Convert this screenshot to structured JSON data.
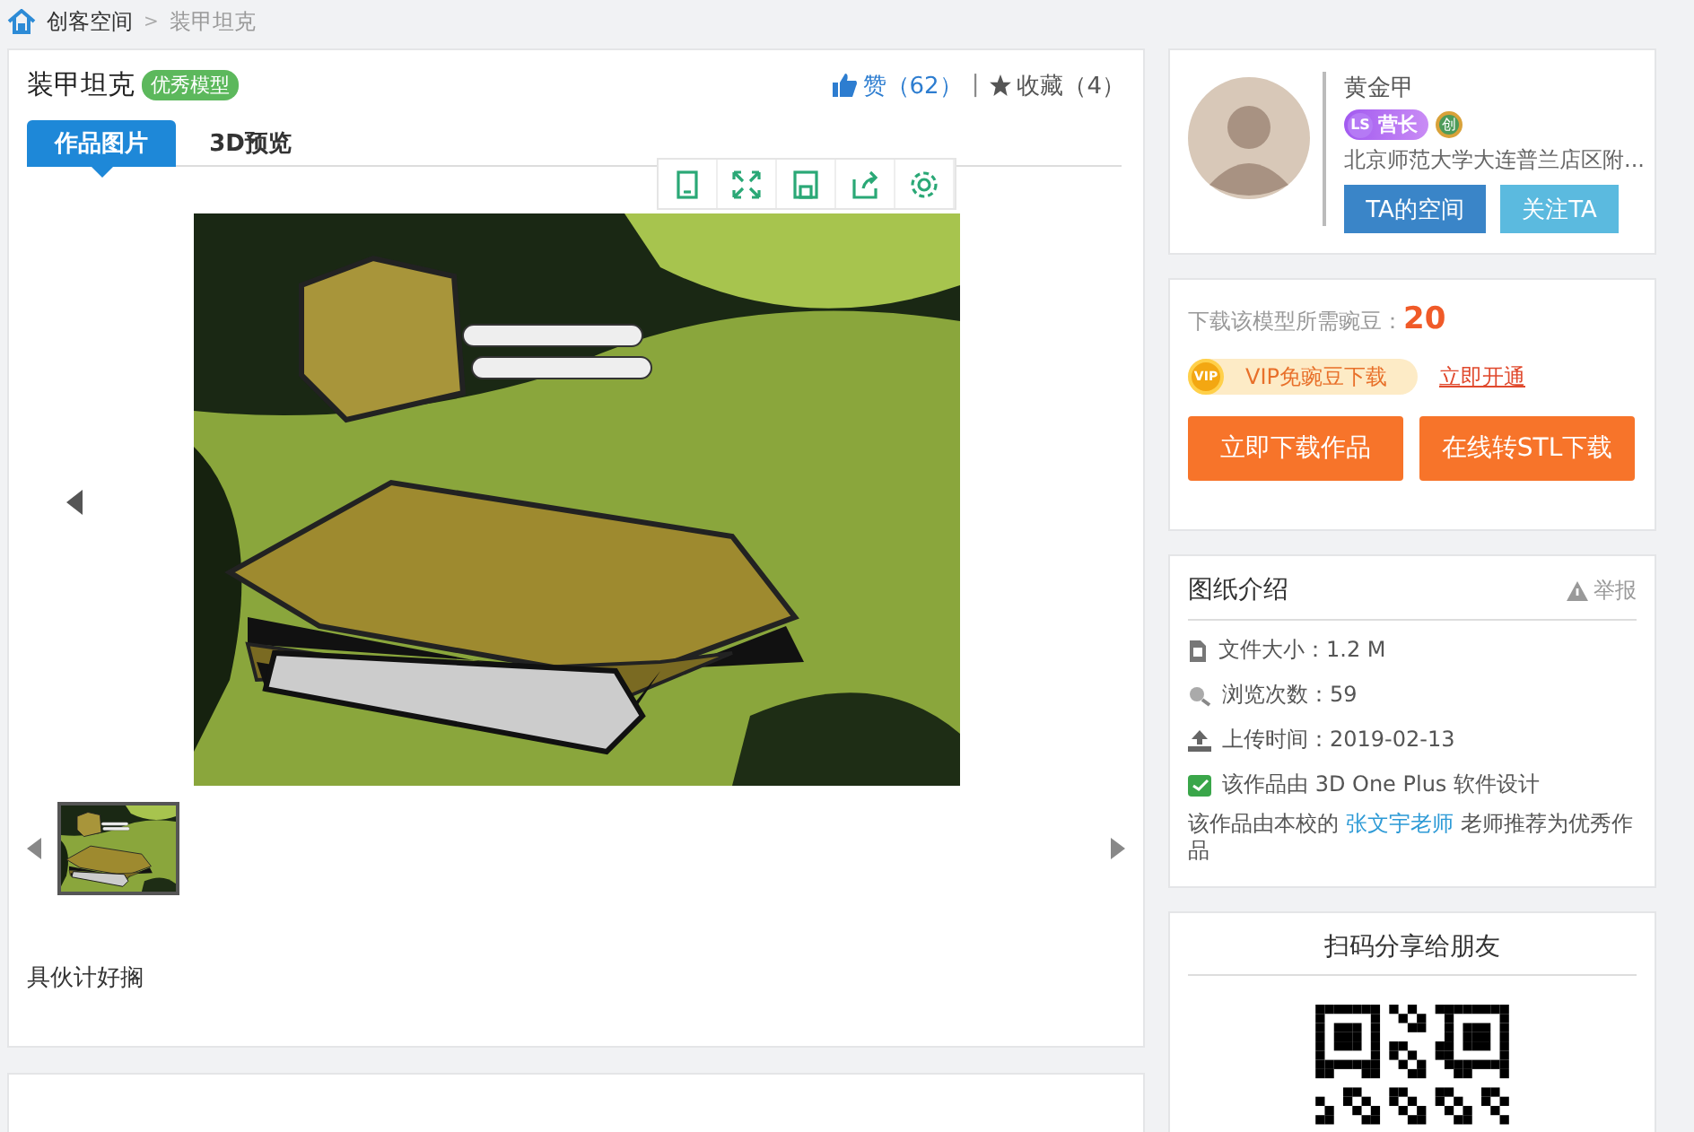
{
  "breadcrumb": {
    "items": [
      "创客空间",
      "装甲坦克"
    ],
    "separator": ">"
  },
  "work": {
    "title": "装甲坦克",
    "badge": "优秀模型",
    "like_label": "赞（62）",
    "separator": "|",
    "favorite_label": "收藏（4）",
    "tabs": [
      {
        "label": "作品图片",
        "selected": true
      },
      {
        "label": "3D预览",
        "selected": false
      }
    ],
    "description": "具伙计好搁"
  },
  "author": {
    "name": "黄金甲",
    "level_badge": "营长",
    "level_mark": "LS",
    "creator_mark": "创",
    "school": "北京师范大学大连普兰店区附...",
    "buttons": [
      {
        "label": "TA的空间",
        "kind": "primary"
      },
      {
        "label": "关注TA",
        "kind": "secondary"
      }
    ]
  },
  "download": {
    "cost_label": "下载该模型所需豌豆：",
    "cost": "20",
    "vip_mark": "VIP",
    "vip_label": "VIP免豌豆下载",
    "vip_link": "立即开通",
    "buttons": [
      "立即下载作品",
      "在线转STL下载"
    ]
  },
  "intro": {
    "title": "图纸介绍",
    "report": "举报",
    "facts": [
      {
        "kind": "file",
        "text": "文件大小：1.2 M"
      },
      {
        "kind": "views",
        "text": "浏览次数：59"
      },
      {
        "kind": "upload",
        "text": "上传时间：2019-02-13"
      },
      {
        "kind": "software",
        "text": "该作品由 3D One Plus 软件设计"
      }
    ],
    "recommend_before": "该作品由本校的",
    "recommend_link": "张文宇老师",
    "recommend_after": "老师推荐为优秀作品"
  },
  "share": {
    "title": "扫码分享给朋友"
  }
}
